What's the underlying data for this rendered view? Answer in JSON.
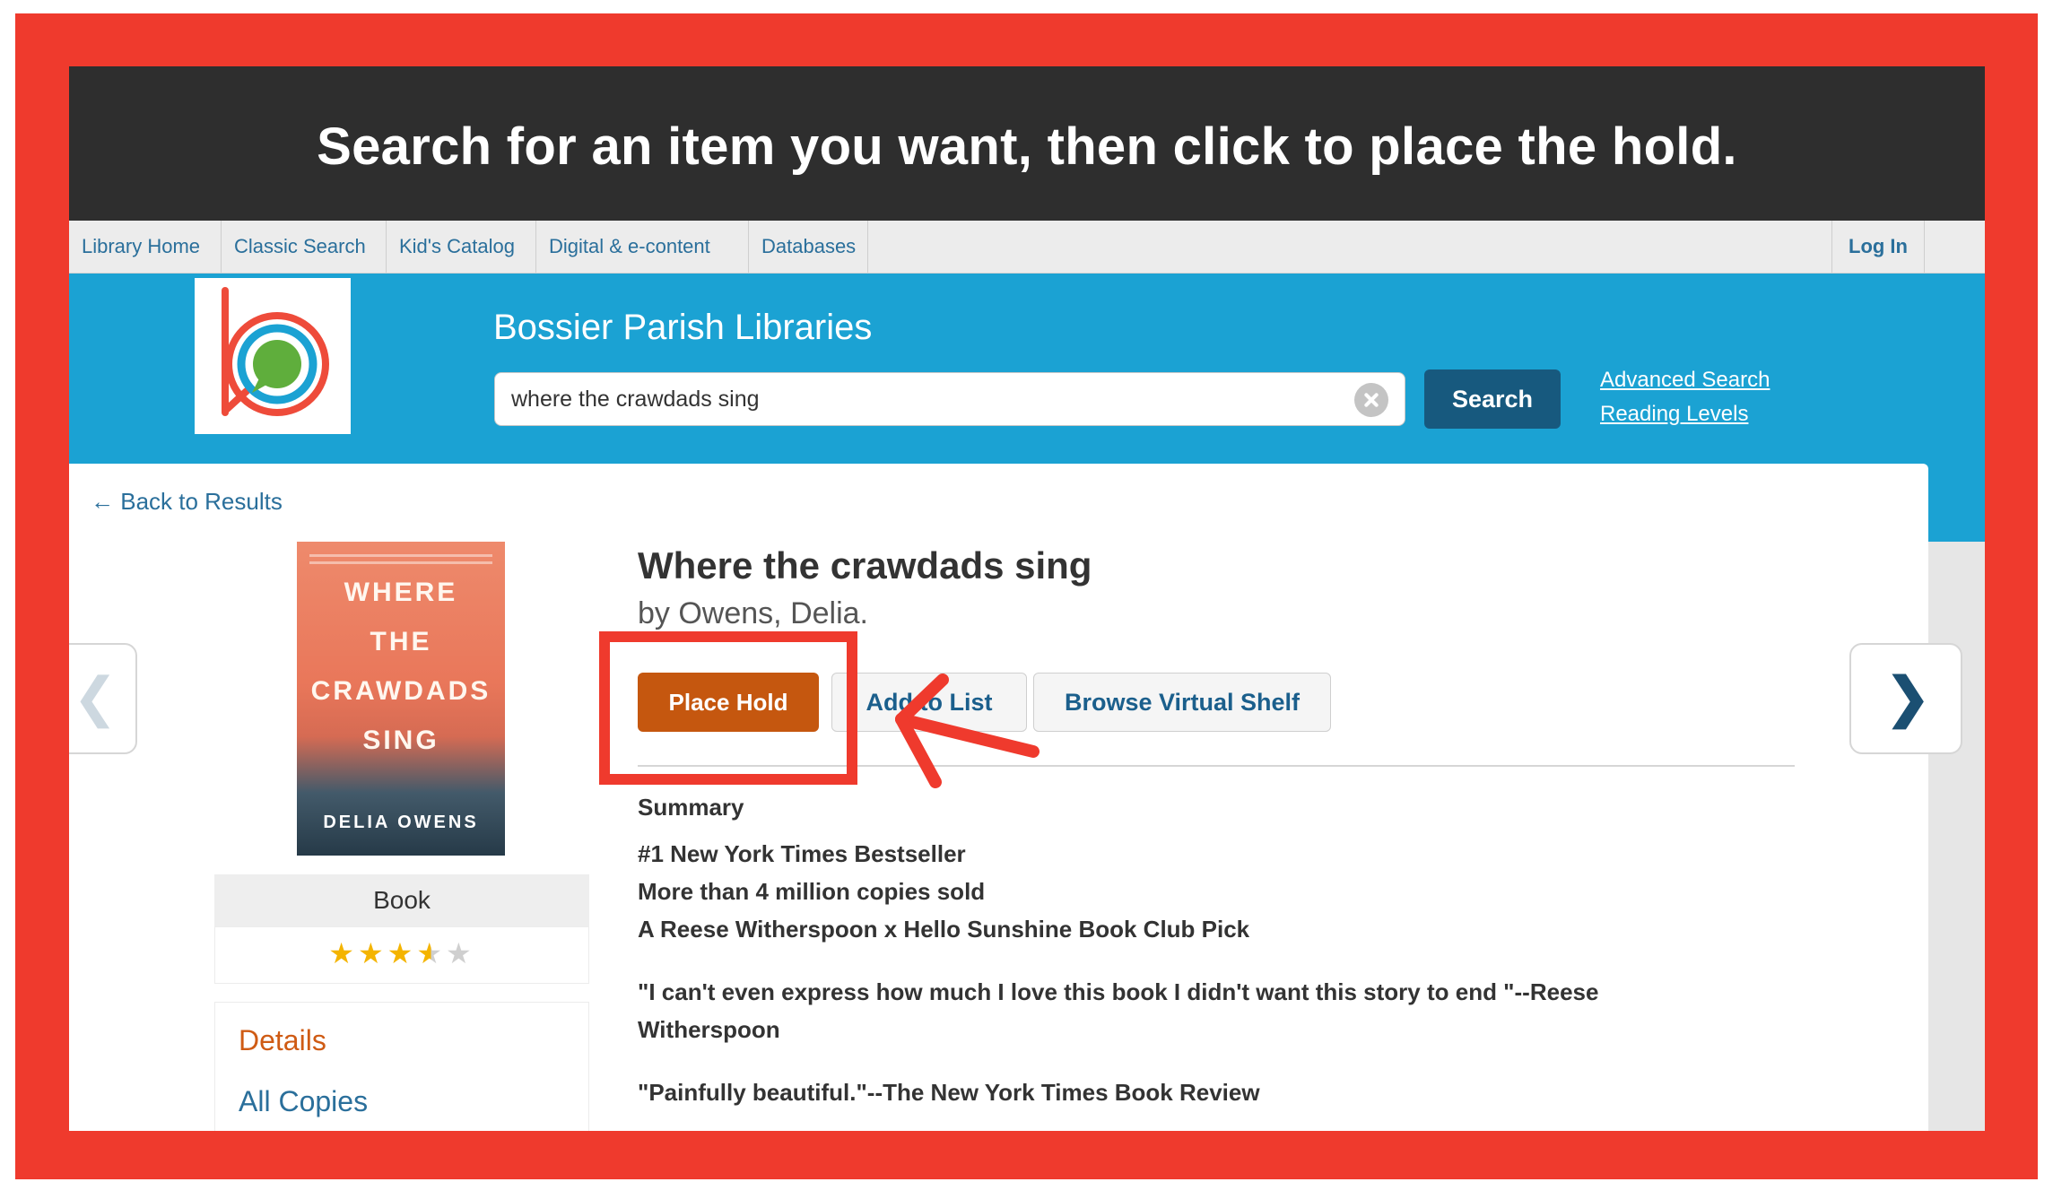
{
  "banner": {
    "text": "Search for an item you want, then click to place the hold."
  },
  "nav": {
    "items": [
      "Library Home",
      "Classic Search",
      "Kid's Catalog",
      "Digital & e-content",
      "Databases"
    ],
    "login": "Log In"
  },
  "header": {
    "site_title": "Bossier Parish Libraries",
    "search_value": "where the crawdads sing",
    "search_button": "Search",
    "advanced_search": "Advanced Search",
    "reading_levels": "Reading Levels"
  },
  "record": {
    "back_link": "← Back to Results",
    "title": "Where the crawdads sing",
    "author": "by Owens, Delia.",
    "cover": {
      "line1": "WHERE",
      "line2": "THE",
      "line3": "CRAWDADS",
      "line4": "SING",
      "author": "DELIA OWENS"
    },
    "format": "Book",
    "rating": 3.5,
    "rating_max": 5,
    "buttons": {
      "place_hold": "Place Hold",
      "add_to_list": "Add to List",
      "browse_shelf": "Browse Virtual Shelf"
    },
    "menu": {
      "details": "Details",
      "all_copies": "All Copies"
    },
    "summary_heading": "Summary",
    "summary_lines": [
      "#1 New York Times Bestseller",
      "More than 4 million copies sold",
      "A Reese Witherspoon x Hello Sunshine Book Club Pick",
      "\"I can't even express how much I love this book I didn't want this story to end \"--Reese",
      "Witherspoon",
      "\"Painfully beautiful.\"--The New York Times Book Review"
    ]
  },
  "colors": {
    "frame": "#ef3a2d",
    "banner": "#2e2e2e",
    "header": "#1ba2d3",
    "place_hold": "#c5570f",
    "search_button": "#17597e"
  }
}
